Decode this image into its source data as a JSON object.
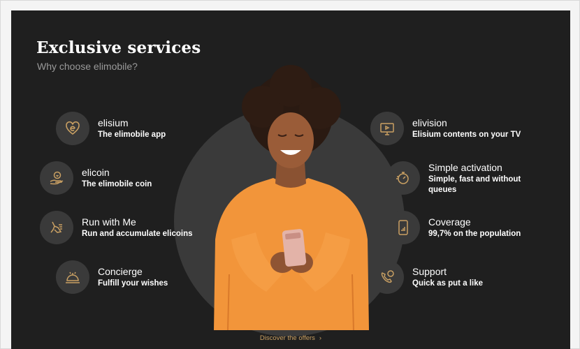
{
  "header": {
    "title": "Exclusive services",
    "subtitle": "Why choose elimobile?"
  },
  "services_left": [
    {
      "name": "elisium",
      "desc": "The elimobile app",
      "icon": "heart-e-icon"
    },
    {
      "name": "elicoin",
      "desc": "The elimobile coin",
      "icon": "coin-hand-icon"
    },
    {
      "name": "Run with Me",
      "desc": "Run and accumulate elicoins",
      "icon": "running-shoe-icon"
    },
    {
      "name": "Concierge",
      "desc": "Fulfill your wishes",
      "icon": "service-bell-icon"
    }
  ],
  "services_right": [
    {
      "name": "elivision",
      "desc": "Elisium contents on your TV",
      "icon": "tv-icon"
    },
    {
      "name": "Simple activation",
      "desc": "Simple, fast and without queues",
      "icon": "stopwatch-icon"
    },
    {
      "name": "Coverage",
      "desc": "99,7% on the population",
      "icon": "phone-signal-icon"
    },
    {
      "name": "Support",
      "desc": "Quick as put a like",
      "icon": "phone-chat-icon"
    }
  ],
  "cta": {
    "label": "Discover the offers",
    "chevron": "›"
  },
  "colors": {
    "panel_bg": "#1f1f1f",
    "icon_bg": "#3a3a3a",
    "accent_gold": "#c9a063",
    "sweater_orange": "#f2953a"
  }
}
